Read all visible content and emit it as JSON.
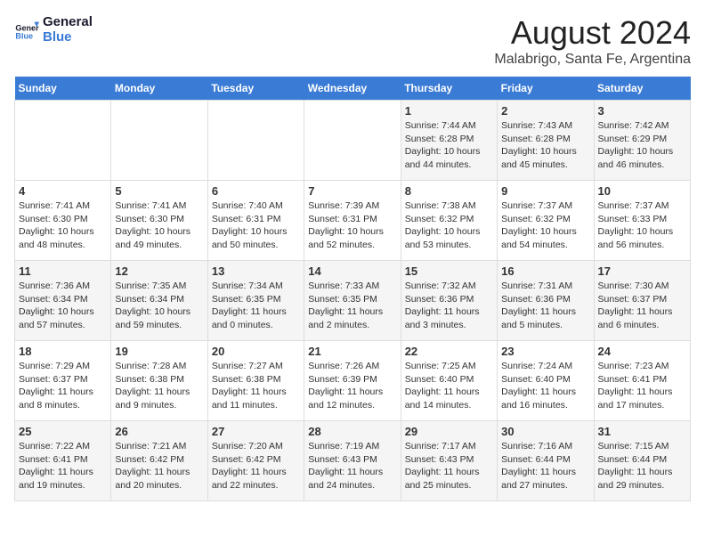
{
  "logo": {
    "line1": "General",
    "line2": "Blue"
  },
  "title": "August 2024",
  "subtitle": "Malabrigo, Santa Fe, Argentina",
  "days_header": [
    "Sunday",
    "Monday",
    "Tuesday",
    "Wednesday",
    "Thursday",
    "Friday",
    "Saturday"
  ],
  "weeks": [
    [
      {
        "day": "",
        "info": ""
      },
      {
        "day": "",
        "info": ""
      },
      {
        "day": "",
        "info": ""
      },
      {
        "day": "",
        "info": ""
      },
      {
        "day": "1",
        "info": "Sunrise: 7:44 AM\nSunset: 6:28 PM\nDaylight: 10 hours\nand 44 minutes."
      },
      {
        "day": "2",
        "info": "Sunrise: 7:43 AM\nSunset: 6:28 PM\nDaylight: 10 hours\nand 45 minutes."
      },
      {
        "day": "3",
        "info": "Sunrise: 7:42 AM\nSunset: 6:29 PM\nDaylight: 10 hours\nand 46 minutes."
      }
    ],
    [
      {
        "day": "4",
        "info": "Sunrise: 7:41 AM\nSunset: 6:30 PM\nDaylight: 10 hours\nand 48 minutes."
      },
      {
        "day": "5",
        "info": "Sunrise: 7:41 AM\nSunset: 6:30 PM\nDaylight: 10 hours\nand 49 minutes."
      },
      {
        "day": "6",
        "info": "Sunrise: 7:40 AM\nSunset: 6:31 PM\nDaylight: 10 hours\nand 50 minutes."
      },
      {
        "day": "7",
        "info": "Sunrise: 7:39 AM\nSunset: 6:31 PM\nDaylight: 10 hours\nand 52 minutes."
      },
      {
        "day": "8",
        "info": "Sunrise: 7:38 AM\nSunset: 6:32 PM\nDaylight: 10 hours\nand 53 minutes."
      },
      {
        "day": "9",
        "info": "Sunrise: 7:37 AM\nSunset: 6:32 PM\nDaylight: 10 hours\nand 54 minutes."
      },
      {
        "day": "10",
        "info": "Sunrise: 7:37 AM\nSunset: 6:33 PM\nDaylight: 10 hours\nand 56 minutes."
      }
    ],
    [
      {
        "day": "11",
        "info": "Sunrise: 7:36 AM\nSunset: 6:34 PM\nDaylight: 10 hours\nand 57 minutes."
      },
      {
        "day": "12",
        "info": "Sunrise: 7:35 AM\nSunset: 6:34 PM\nDaylight: 10 hours\nand 59 minutes."
      },
      {
        "day": "13",
        "info": "Sunrise: 7:34 AM\nSunset: 6:35 PM\nDaylight: 11 hours\nand 0 minutes."
      },
      {
        "day": "14",
        "info": "Sunrise: 7:33 AM\nSunset: 6:35 PM\nDaylight: 11 hours\nand 2 minutes."
      },
      {
        "day": "15",
        "info": "Sunrise: 7:32 AM\nSunset: 6:36 PM\nDaylight: 11 hours\nand 3 minutes."
      },
      {
        "day": "16",
        "info": "Sunrise: 7:31 AM\nSunset: 6:36 PM\nDaylight: 11 hours\nand 5 minutes."
      },
      {
        "day": "17",
        "info": "Sunrise: 7:30 AM\nSunset: 6:37 PM\nDaylight: 11 hours\nand 6 minutes."
      }
    ],
    [
      {
        "day": "18",
        "info": "Sunrise: 7:29 AM\nSunset: 6:37 PM\nDaylight: 11 hours\nand 8 minutes."
      },
      {
        "day": "19",
        "info": "Sunrise: 7:28 AM\nSunset: 6:38 PM\nDaylight: 11 hours\nand 9 minutes."
      },
      {
        "day": "20",
        "info": "Sunrise: 7:27 AM\nSunset: 6:38 PM\nDaylight: 11 hours\nand 11 minutes."
      },
      {
        "day": "21",
        "info": "Sunrise: 7:26 AM\nSunset: 6:39 PM\nDaylight: 11 hours\nand 12 minutes."
      },
      {
        "day": "22",
        "info": "Sunrise: 7:25 AM\nSunset: 6:40 PM\nDaylight: 11 hours\nand 14 minutes."
      },
      {
        "day": "23",
        "info": "Sunrise: 7:24 AM\nSunset: 6:40 PM\nDaylight: 11 hours\nand 16 minutes."
      },
      {
        "day": "24",
        "info": "Sunrise: 7:23 AM\nSunset: 6:41 PM\nDaylight: 11 hours\nand 17 minutes."
      }
    ],
    [
      {
        "day": "25",
        "info": "Sunrise: 7:22 AM\nSunset: 6:41 PM\nDaylight: 11 hours\nand 19 minutes."
      },
      {
        "day": "26",
        "info": "Sunrise: 7:21 AM\nSunset: 6:42 PM\nDaylight: 11 hours\nand 20 minutes."
      },
      {
        "day": "27",
        "info": "Sunrise: 7:20 AM\nSunset: 6:42 PM\nDaylight: 11 hours\nand 22 minutes."
      },
      {
        "day": "28",
        "info": "Sunrise: 7:19 AM\nSunset: 6:43 PM\nDaylight: 11 hours\nand 24 minutes."
      },
      {
        "day": "29",
        "info": "Sunrise: 7:17 AM\nSunset: 6:43 PM\nDaylight: 11 hours\nand 25 minutes."
      },
      {
        "day": "30",
        "info": "Sunrise: 7:16 AM\nSunset: 6:44 PM\nDaylight: 11 hours\nand 27 minutes."
      },
      {
        "day": "31",
        "info": "Sunrise: 7:15 AM\nSunset: 6:44 PM\nDaylight: 11 hours\nand 29 minutes."
      }
    ]
  ]
}
